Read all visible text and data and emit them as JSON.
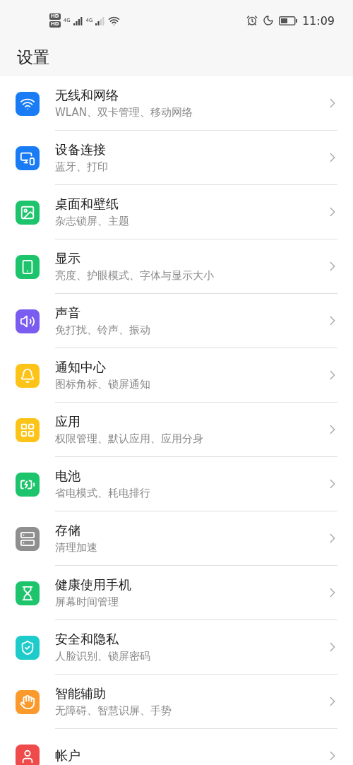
{
  "status_bar": {
    "sims": [
      {
        "hd": "HD",
        "network": "4G"
      },
      {
        "hd": "HD",
        "network": "4G"
      }
    ],
    "time": "11:09"
  },
  "title": "设置",
  "items": [
    {
      "title": "无线和网络",
      "subtitle": "WLAN、双卡管理、移动网络",
      "color": "#1a7cf5"
    },
    {
      "title": "设备连接",
      "subtitle": "蓝牙、打印",
      "color": "#1a7cf5"
    },
    {
      "title": "桌面和壁纸",
      "subtitle": "杂志锁屏、主题",
      "color": "#1dc46c"
    },
    {
      "title": "显示",
      "subtitle": "亮度、护眼模式、字体与显示大小",
      "color": "#1dc46c"
    },
    {
      "title": "声音",
      "subtitle": "免打扰、铃声、振动",
      "color": "#7a5cf0"
    },
    {
      "title": "通知中心",
      "subtitle": "图标角标、锁屏通知",
      "color": "#fcc419"
    },
    {
      "title": "应用",
      "subtitle": "权限管理、默认应用、应用分身",
      "color": "#fcc419"
    },
    {
      "title": "电池",
      "subtitle": "省电模式、耗电排行",
      "color": "#1dc46c"
    },
    {
      "title": "存储",
      "subtitle": "清理加速",
      "color": "#8f8f8f"
    },
    {
      "title": "健康使用手机",
      "subtitle": "屏幕时间管理",
      "color": "#1dc46c"
    },
    {
      "title": "安全和隐私",
      "subtitle": "人脸识别、锁屏密码",
      "color": "#1ecbcb"
    },
    {
      "title": "智能辅助",
      "subtitle": "无障碍、智慧识屏、手势",
      "color": "#fb9a2c"
    },
    {
      "title": "帐户",
      "color": "#f04b4b"
    }
  ]
}
